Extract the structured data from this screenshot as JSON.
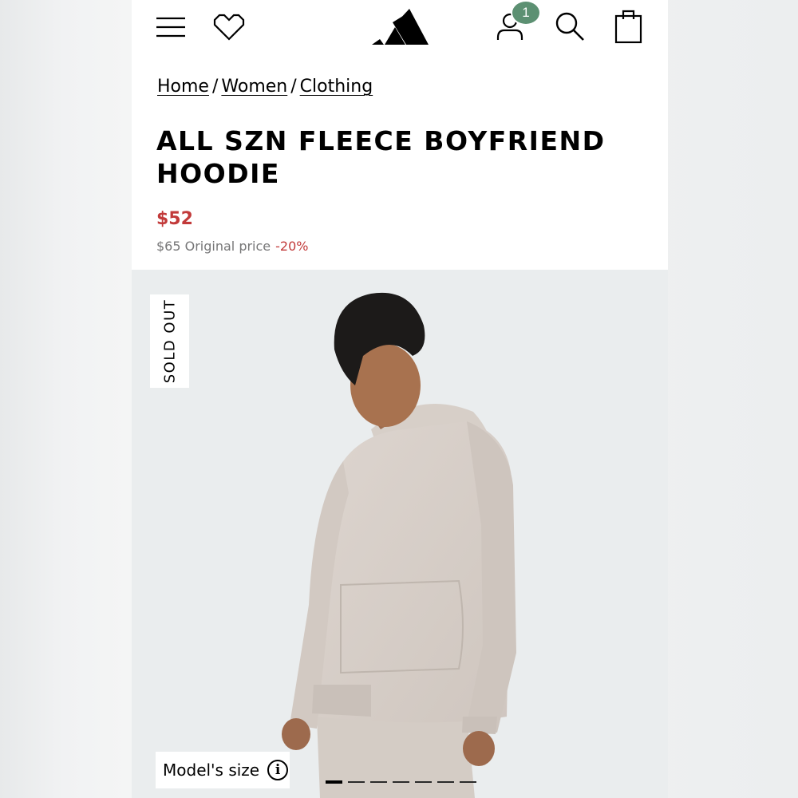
{
  "header": {
    "badge_count": "1",
    "icons": [
      "menu-icon",
      "heart-icon",
      "adidas-logo",
      "account-icon",
      "search-icon",
      "bag-icon"
    ]
  },
  "breadcrumb": {
    "items": [
      "Home",
      "Women",
      "Clothing"
    ],
    "separator": "/"
  },
  "product": {
    "title": "ALL SZN FLEECE BOYFRIEND HOODIE",
    "sale_price": "$52",
    "original_price": "$65 Original price",
    "discount": "-20%"
  },
  "image": {
    "sold_out_label": "SOLD OUT",
    "model_size_label": "Model's size",
    "carousel_slides": 7,
    "active_slide": 1
  },
  "colors": {
    "sale_red": "#c23a3a",
    "badge_green": "#5c9072",
    "hero_bg": "#eaedee"
  }
}
